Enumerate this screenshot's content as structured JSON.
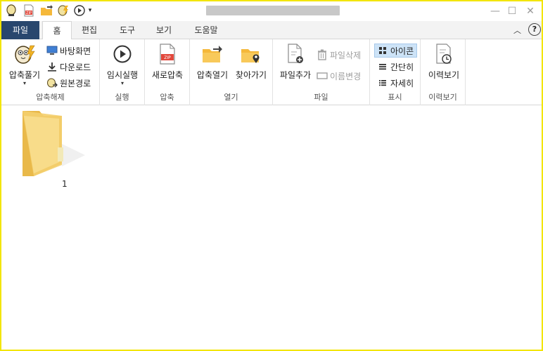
{
  "quick_access": [
    {
      "name": "app-logo-icon"
    },
    {
      "name": "zip-icon"
    },
    {
      "name": "open-folder-icon"
    },
    {
      "name": "extract-icon"
    },
    {
      "name": "play-icon"
    },
    {
      "name": "customize-dropdown-icon"
    }
  ],
  "window_controls": {
    "minimize": "—",
    "maximize": "☐",
    "close": "✕"
  },
  "tabs": [
    {
      "label": "파일"
    },
    {
      "label": "홈"
    },
    {
      "label": "편집"
    },
    {
      "label": "도구"
    },
    {
      "label": "보기"
    },
    {
      "label": "도움말"
    }
  ],
  "ribbon": {
    "extract_group": {
      "label": "압축해제",
      "big_label": "압축풀기",
      "items": [
        "바탕화면",
        "다운로드",
        "원본경로"
      ]
    },
    "run_group": {
      "label": "실행",
      "big_label": "임시실행"
    },
    "compress_group": {
      "label": "압축",
      "big_label": "새로압축"
    },
    "open_group": {
      "label": "열기",
      "open_label": "압축열기",
      "find_label": "찾아가기"
    },
    "file_group": {
      "label": "파일",
      "add_label": "파일추가",
      "delete_label": "파일삭제",
      "rename_label": "이름변경"
    },
    "view_group": {
      "label": "표시",
      "items": [
        "아이콘",
        "간단히",
        "자세히"
      ],
      "selected": "아이콘"
    },
    "history_group": {
      "label": "이력보기",
      "big_label": "이력보기"
    }
  },
  "help_symbol": "?",
  "collapse_symbol": "︿",
  "files": [
    {
      "name": "1",
      "type": "folder"
    }
  ],
  "colors": {
    "file_tab": "#29476e",
    "border": "#f3e500",
    "selected_view": "#cde3f7",
    "folder": "#f5cf6b"
  }
}
